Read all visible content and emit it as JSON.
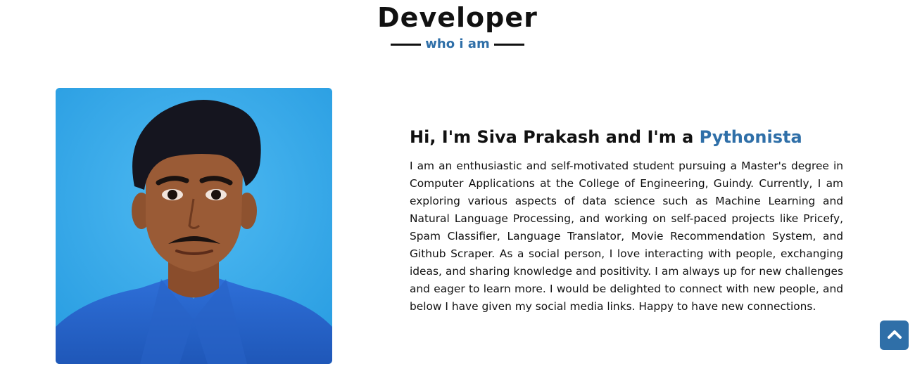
{
  "section": {
    "title": "Developer",
    "subtitle": "who i am"
  },
  "about": {
    "photo_alt": "Portrait of Siva Prakash",
    "heading_prefix": "Hi, I'm Siva Prakash and I'm a",
    "heading_accent": "Pythonista",
    "bio": "I am an enthusiastic and self-motivated student pursuing a Master's degree in Computer Applications at the College of Engineering, Guindy. Currently, I am exploring various aspects of data science such as Machine Learning and Natural Language Processing, and working on self-paced projects like Pricefy, Spam Classifier, Language Translator, Movie Recommendation System, and Github Scraper. As a social person, I love interacting with people, exchanging ideas, and sharing knowledge and positivity. I am always up for new challenges and eager to learn more. I would be delighted to connect with new people, and below I have given my social media links. Happy to have new connections."
  },
  "scroll_top": {
    "icon": "chevron-up-icon"
  },
  "colors": {
    "accent": "#2f6fa8",
    "photo_background": "#33a7e8",
    "text": "#111111"
  }
}
